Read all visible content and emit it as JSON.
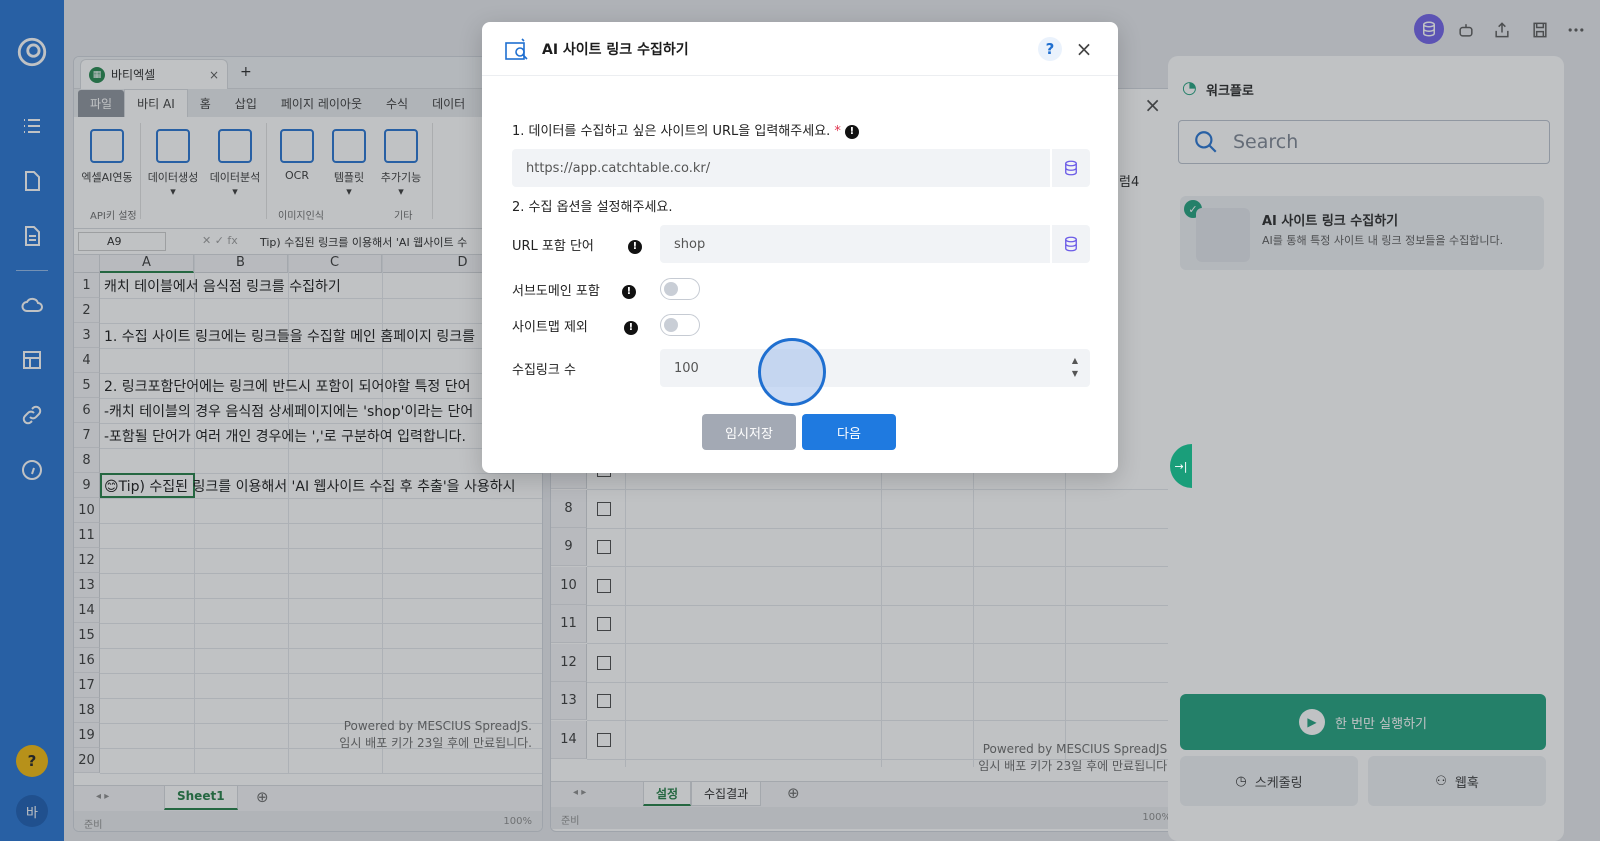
{
  "sidebar": {
    "help": "?",
    "user": "바"
  },
  "left_workbook": {
    "tab_title": "바티엑셀",
    "new_tab": "+",
    "ribbon_tabs": [
      "파일",
      "바티 AI",
      "홈",
      "삽입",
      "페이지 레이아웃",
      "수식",
      "데이터"
    ],
    "ribbon_buttons": [
      "엑셀AI연동",
      "데이터생성",
      "데이터분석",
      "OCR",
      "템플릿",
      "추가기능"
    ],
    "ribbon_groups": [
      "API키 설정",
      "이미지인식",
      "기타"
    ],
    "namebox": "A9",
    "formula": "Tip) 수집된 링크를 이용해서 'AI 웹사이트 수",
    "columns": [
      "A",
      "B",
      "C",
      "D"
    ],
    "rows": [
      "1",
      "2",
      "3",
      "4",
      "5",
      "6",
      "7",
      "8",
      "9",
      "10",
      "11",
      "12",
      "13",
      "14",
      "15",
      "16",
      "17",
      "18",
      "19",
      "20"
    ],
    "cells": {
      "r1": "캐치 테이블에서 음식점 링크를 수집하기",
      "r3": "1. 수집 사이트 링크에는 링크들을 수집할 메인 홈페이지 링크를",
      "r5": "2. 링크포함단어에는 링크에 반드시 포함이 되어야할 특정 단어",
      "r6": "-캐치 테이블의 경우 음식점 상세페이지에는 'shop'이라는 단어",
      "r7": "-포함될 단어가 여러 개인 경우에는 ','로 구분하여 입력합니다.",
      "r9": "😊Tip) 수집된 링크를 이용해서 'AI 웹사이트 수집 후 추출'을 사용하시"
    },
    "watermark_1": "Powered by MESCIUS SpreadJS.",
    "watermark_2": "임시 배포 키가 23일 후에 만료됩니다.",
    "sheet_tab": "Sheet1",
    "status": "준비",
    "zoom": "100%"
  },
  "right_workbook": {
    "col_label": "럼4",
    "rows": [
      "7",
      "8",
      "9",
      "10",
      "11",
      "12",
      "13",
      "14"
    ],
    "watermark_1": "Powered by MESCIUS SpreadJS.",
    "watermark_2": "임시 배포 키가 23일 후에 만료됩니다.",
    "sheet_tabs": [
      "설정",
      "수집결과"
    ],
    "status": "준비",
    "zoom": "100%"
  },
  "workflow_panel": {
    "title": "워크플로",
    "search_placeholder": "Search",
    "card_title": "AI 사이트 링크 수집하기",
    "card_desc": "AI를 통해 특정 사이트 내 링크 정보들을 수집합니다.",
    "run_once": "한 번만 실행하기",
    "schedule": "스케줄링",
    "webhook": "웹훅"
  },
  "modal": {
    "title": "AI 사이트 링크 수집하기",
    "help": "?",
    "close": "×",
    "q1": "1. 데이터를 수집하고 싶은 사이트의 URL을 입력해주세요.",
    "required_mark": "*",
    "url_value": "https://app.catchtable.co.kr/",
    "q2": "2. 수집 옵션을 설정해주세요.",
    "url_word_label": "URL 포함 단어",
    "url_word_value": "shop",
    "subdomain_label": "서브도메인 포함",
    "sitemap_label": "사이트맵 제외",
    "count_label": "수집링크 수",
    "count_value": "100",
    "save_button": "임시저장",
    "next_button": "다음"
  },
  "colors": {
    "brand": "#1f6fd0",
    "run": "#1a9e7a",
    "next": "#1f7ae0",
    "save": "#a3a9b4"
  }
}
